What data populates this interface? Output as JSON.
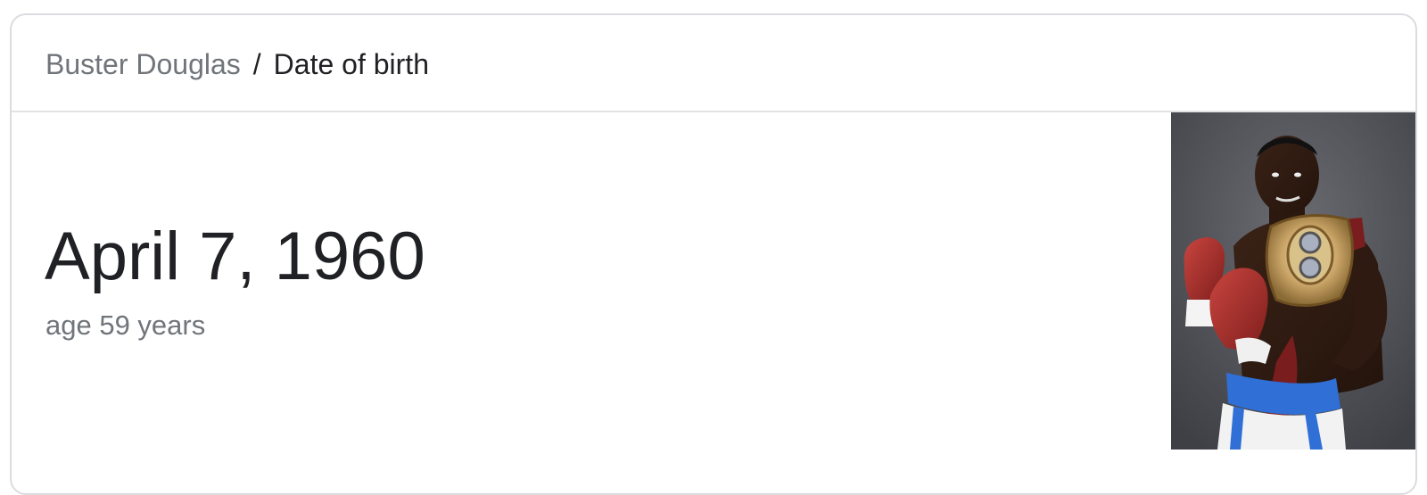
{
  "breadcrumb": {
    "parent": "Buster Douglas",
    "separator": "/",
    "current": "Date of birth"
  },
  "answer": {
    "value": "April 7, 1960",
    "subtext": "age 59 years"
  },
  "photo": {
    "subject": "boxer-with-championship-belt"
  }
}
